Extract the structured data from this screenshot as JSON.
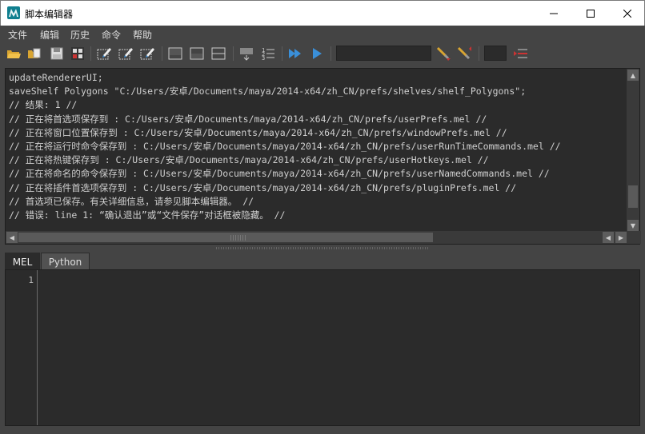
{
  "window": {
    "title": "脚本编辑器",
    "minimize_glyph": "—",
    "maximize_glyph": "☐",
    "close_glyph": "✕"
  },
  "menu": {
    "items": [
      "文件",
      "编辑",
      "历史",
      "命令",
      "帮助"
    ]
  },
  "toolbar": {
    "icons": [
      "open-script-icon",
      "source-script-icon",
      "save-script-icon",
      "save-to-shelf-icon",
      "clear-history-icon",
      "clear-input-icon",
      "clear-all-icon",
      "show-history-only-icon",
      "show-input-only-icon",
      "show-both-icon",
      "echo-all-commands-icon",
      "line-numbers-icon",
      "execute-all-icon",
      "execute-icon",
      "search-icon",
      "search-down-icon",
      "line-field",
      "goto-line-icon"
    ],
    "search_value": "",
    "line_value": ""
  },
  "history": {
    "lines": [
      "updateRendererUI;",
      "saveShelf Polygons \"C:/Users/安卓/Documents/maya/2014-x64/zh_CN/prefs/shelves/shelf_Polygons\";",
      "// 结果: 1 //",
      "// 正在将首选项保存到 : C:/Users/安卓/Documents/maya/2014-x64/zh_CN/prefs/userPrefs.mel //",
      "// 正在将窗口位置保存到 : C:/Users/安卓/Documents/maya/2014-x64/zh_CN/prefs/windowPrefs.mel //",
      "// 正在将运行时命令保存到 : C:/Users/安卓/Documents/maya/2014-x64/zh_CN/prefs/userRunTimeCommands.mel //",
      "// 正在将热键保存到 : C:/Users/安卓/Documents/maya/2014-x64/zh_CN/prefs/userHotkeys.mel //",
      "// 正在将命名的命令保存到 : C:/Users/安卓/Documents/maya/2014-x64/zh_CN/prefs/userNamedCommands.mel //",
      "// 正在将插件首选项保存到 : C:/Users/安卓/Documents/maya/2014-x64/zh_CN/prefs/pluginPrefs.mel //",
      "// 首选项已保存。有关详细信息，请参见脚本编辑器。 //",
      "// 错误: line 1: “确认退出”或“文件保存”对话框被隐藏。 //"
    ]
  },
  "tabs": [
    {
      "label": "MEL",
      "active": true
    },
    {
      "label": "Python",
      "active": false
    }
  ],
  "editor": {
    "line_number": "1",
    "content": ""
  },
  "colors": {
    "panel_bg": "#444444",
    "field_bg": "#2b2b2b",
    "text": "#cfcfcf",
    "icon_blue": "#3a8fd8"
  }
}
